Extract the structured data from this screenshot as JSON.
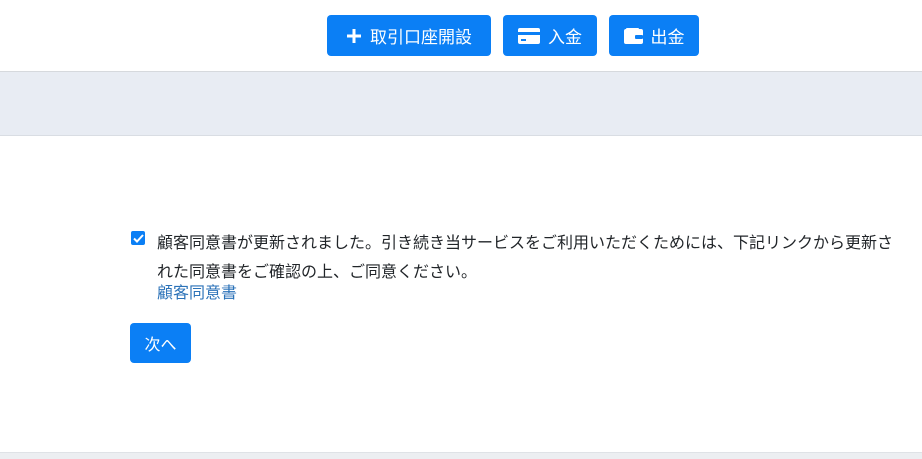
{
  "header": {
    "open_account_label": "取引口座開設",
    "deposit_label": "入金",
    "withdraw_label": "出金"
  },
  "notice": {
    "checkbox_checked": true,
    "message": "顧客同意書が更新されました。引き続き当サービスをご利用いただくためには、下記リンクから更新された同意書をご確認の上、ご同意ください。",
    "link_text": "顧客同意書",
    "next_label": "次へ"
  },
  "colors": {
    "primary": "#0b7ff5",
    "band": "#e8ecf3",
    "link": "#2b72b8"
  }
}
